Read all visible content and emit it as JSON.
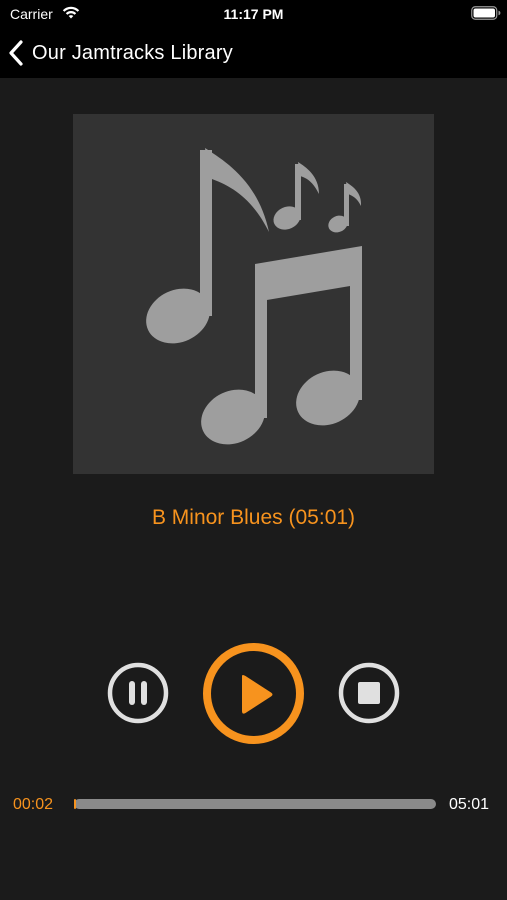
{
  "status_bar": {
    "carrier": "Carrier",
    "time": "11:17 PM",
    "wifi_icon": "wifi-icon",
    "battery_icon": "battery-icon"
  },
  "nav": {
    "back_label": "Our Jamtracks Library",
    "back_icon": "chevron-left-icon"
  },
  "artwork": {
    "icon": "music-notes-icon",
    "background_color": "#333333",
    "note_color": "#9e9e9e"
  },
  "track": {
    "title": "B Minor Blues (05:01)"
  },
  "controls": {
    "pause_icon": "pause-icon",
    "play_icon": "play-icon",
    "stop_icon": "stop-icon"
  },
  "progress": {
    "elapsed": "00:02",
    "total": "05:01",
    "fraction": 0.0066
  },
  "colors": {
    "accent": "#f7931e",
    "background": "#1b1b1b",
    "bar_background": "#000000",
    "control_ring": "#e0e0e0"
  }
}
